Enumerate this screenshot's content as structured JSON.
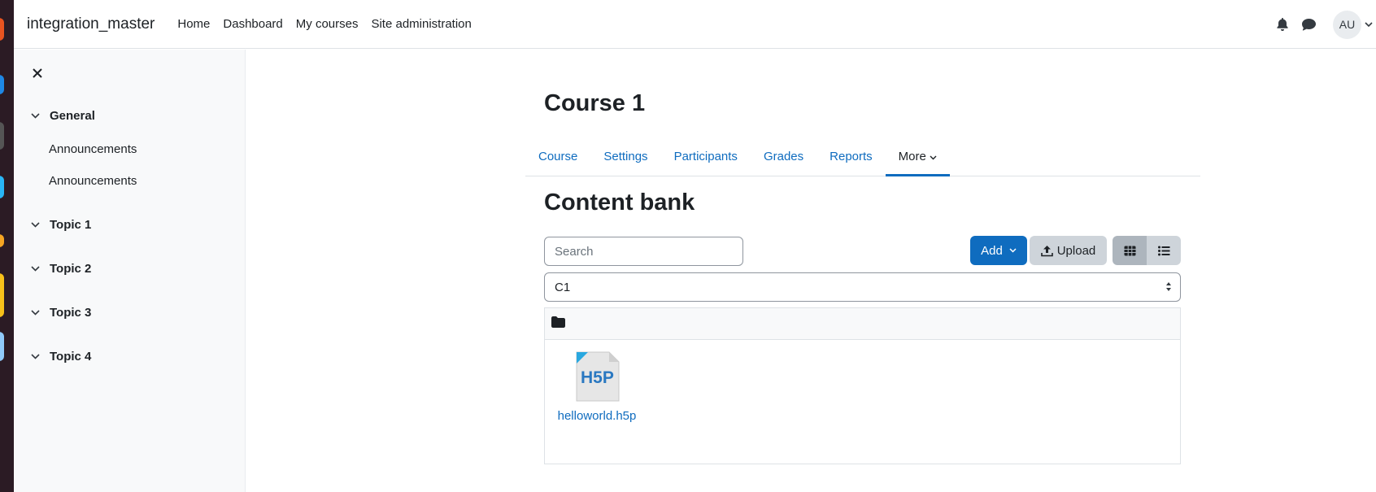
{
  "navbar": {
    "brand": "integration_master",
    "links": [
      "Home",
      "Dashboard",
      "My courses",
      "Site administration"
    ],
    "avatar_initials": "AU",
    "icons": [
      "bell-icon",
      "chat-icon"
    ]
  },
  "drawer": {
    "sections": [
      {
        "label": "General",
        "activities": [
          "Announcements",
          "Announcements"
        ]
      },
      {
        "label": "Topic 1",
        "activities": []
      },
      {
        "label": "Topic 2",
        "activities": []
      },
      {
        "label": "Topic 3",
        "activities": []
      },
      {
        "label": "Topic 4",
        "activities": []
      }
    ]
  },
  "course": {
    "title": "Course 1",
    "tabs": [
      "Course",
      "Settings",
      "Participants",
      "Grades",
      "Reports",
      "More"
    ],
    "active_tab": "More"
  },
  "content_bank": {
    "title": "Content bank",
    "search_placeholder": "Search",
    "add_label": "Add",
    "upload_label": "Upload",
    "context_selected": "C1",
    "files": [
      {
        "name": "helloworld.h5p",
        "icon": "h5p-file-icon"
      }
    ]
  },
  "colors": {
    "primary": "#0f6cbf",
    "text": "#1d2125",
    "drawer_bg": "#f8f9fa"
  }
}
